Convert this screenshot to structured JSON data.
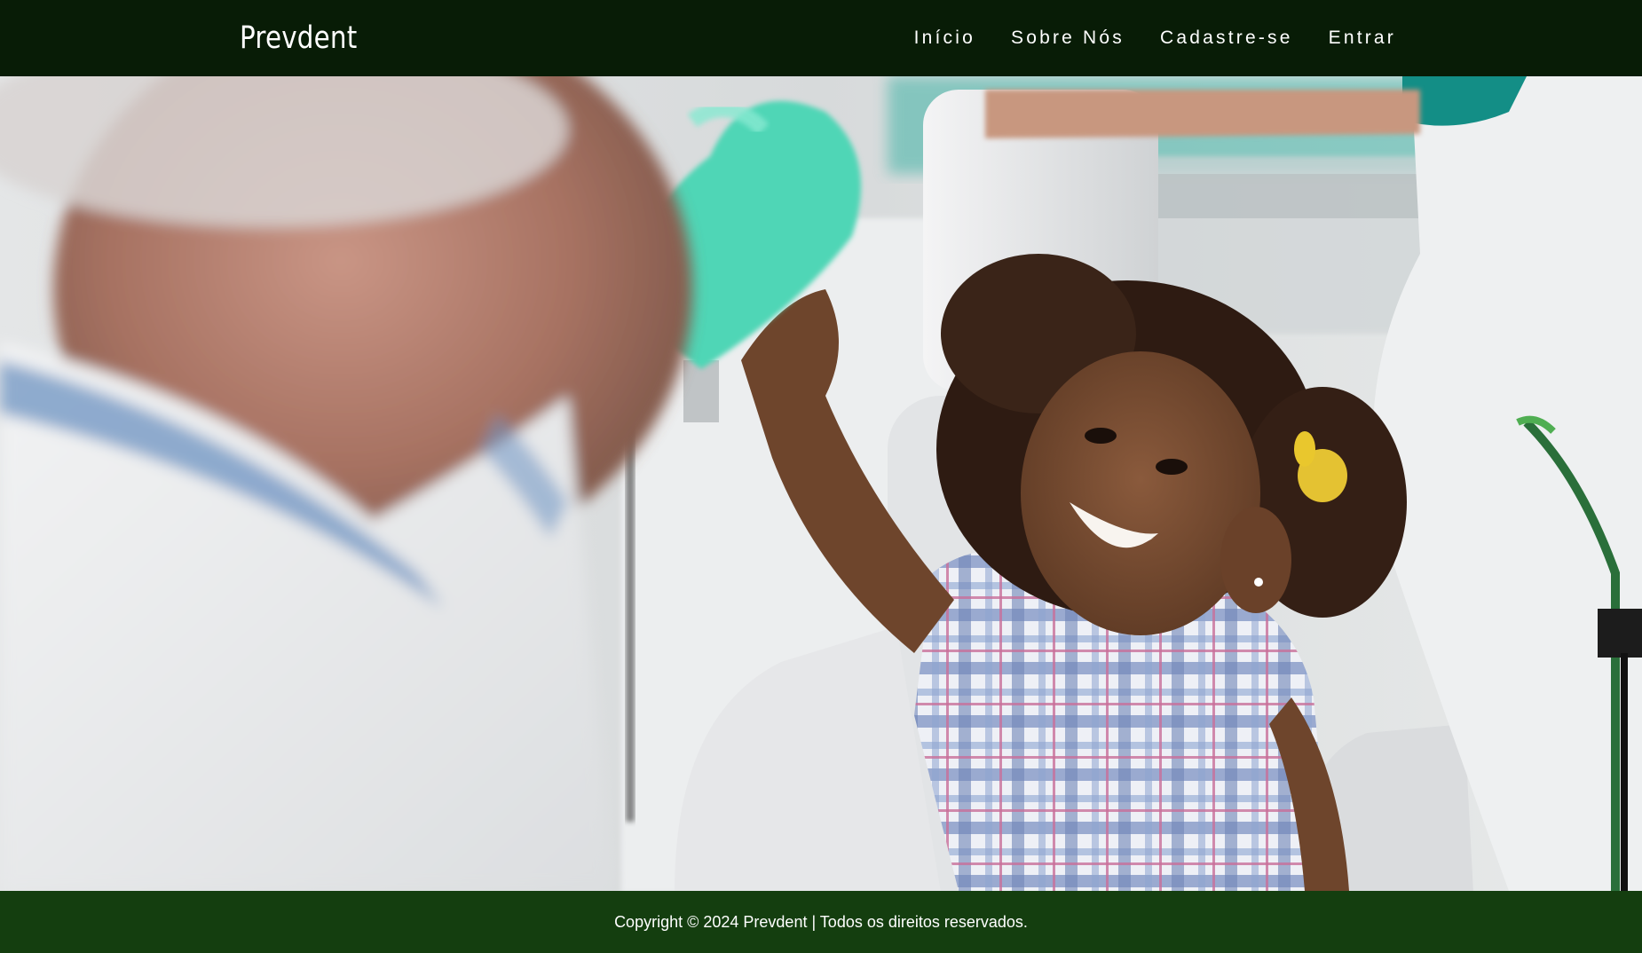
{
  "navbar": {
    "brand": "Prevdent",
    "links": [
      {
        "label": "Início"
      },
      {
        "label": "Sobre Nós"
      },
      {
        "label": "Cadastre-se"
      },
      {
        "label": "Entrar"
      }
    ],
    "background_color": "#081c06"
  },
  "hero": {
    "image_icon": "dental-care-photo"
  },
  "footer": {
    "copyright": "Copyright © 2024 Prevdent | Todos os direitos reservados.",
    "background_color": "#143e0f"
  }
}
